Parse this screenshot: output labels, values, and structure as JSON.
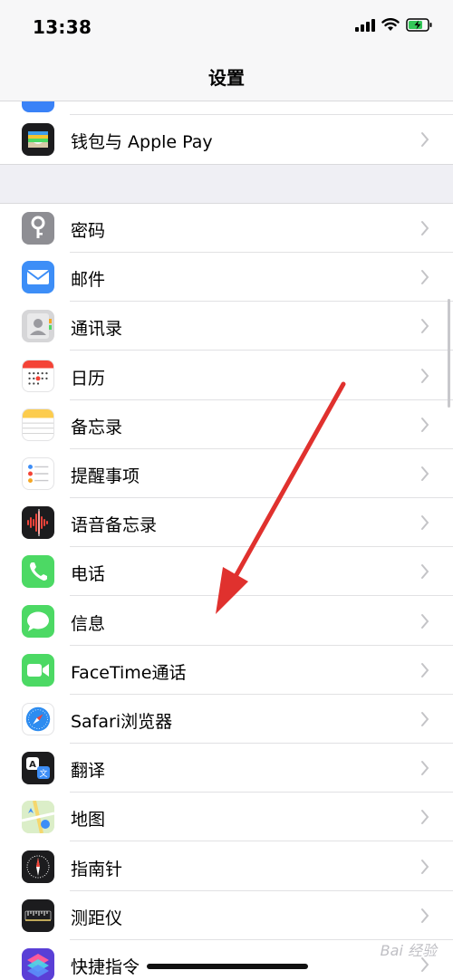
{
  "status_bar": {
    "time": "13:38"
  },
  "nav": {
    "title": "设置"
  },
  "top_partial_row": {
    "label": "—"
  },
  "wallet_row": {
    "label": "钱包与 Apple Pay",
    "icon": "wallet-icon"
  },
  "items": [
    {
      "label": "密码",
      "icon": "key-icon"
    },
    {
      "label": "邮件",
      "icon": "mail-icon"
    },
    {
      "label": "通讯录",
      "icon": "contacts-icon"
    },
    {
      "label": "日历",
      "icon": "calendar-icon"
    },
    {
      "label": "备忘录",
      "icon": "notes-icon"
    },
    {
      "label": "提醒事项",
      "icon": "reminders-icon"
    },
    {
      "label": "语音备忘录",
      "icon": "voice-memos-icon"
    },
    {
      "label": "电话",
      "icon": "phone-icon"
    },
    {
      "label": "信息",
      "icon": "messages-icon"
    },
    {
      "label": "FaceTime通话",
      "icon": "facetime-icon"
    },
    {
      "label": "Safari浏览器",
      "icon": "safari-icon"
    },
    {
      "label": "翻译",
      "icon": "translate-icon"
    },
    {
      "label": "地图",
      "icon": "maps-icon"
    },
    {
      "label": "指南针",
      "icon": "compass-icon"
    },
    {
      "label": "测距仪",
      "icon": "measure-icon"
    },
    {
      "label": "快捷指令",
      "icon": "shortcuts-icon"
    }
  ],
  "watermark": "Bai 经验",
  "colors": {
    "annotation_arrow": "#e0312e",
    "chevron": "#c4c4c7"
  }
}
